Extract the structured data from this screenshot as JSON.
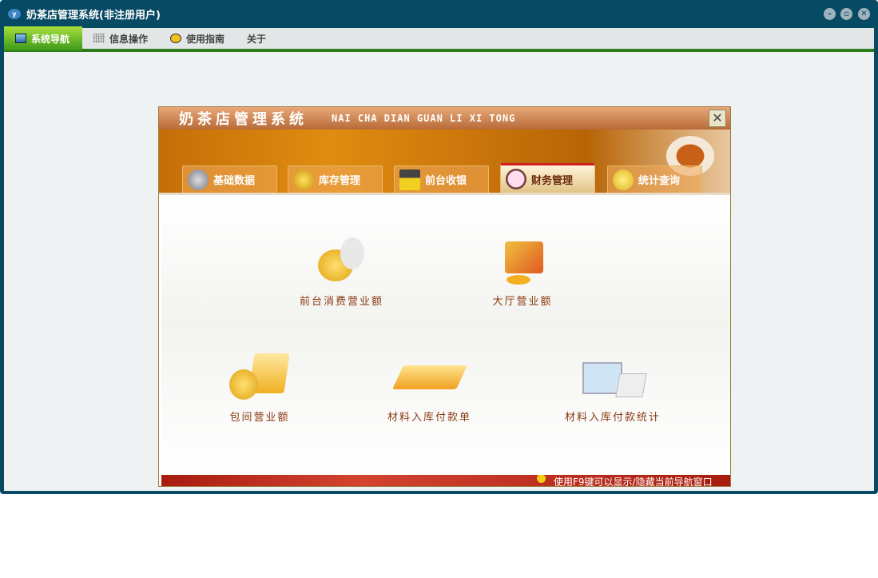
{
  "window": {
    "title": "奶茶店管理系统(非注册用户)"
  },
  "menu": [
    {
      "label": "系统导航"
    },
    {
      "label": "信息操作"
    },
    {
      "label": "使用指南"
    },
    {
      "label": "关于"
    }
  ],
  "dialog": {
    "title": "奶茶店管理系统",
    "subtitle": "NAI CHA DIAN GUAN LI XI TONG",
    "close": "✕",
    "tabs": [
      {
        "label": "基础数据"
      },
      {
        "label": "库存管理"
      },
      {
        "label": "前台收银"
      },
      {
        "label": "财务管理"
      },
      {
        "label": "统计查询"
      }
    ],
    "items": [
      {
        "label": "前台消费营业额"
      },
      {
        "label": "大厅营业额"
      },
      {
        "label": "包间营业额"
      },
      {
        "label": "材料入库付款单"
      },
      {
        "label": "材料入库付款统计"
      }
    ],
    "status": "使用F9键可以显示/隐藏当前导航窗口"
  },
  "colors": {
    "titlebar": "#074a63",
    "menu_active": "#3c9a1a",
    "accent": "#d02020"
  }
}
